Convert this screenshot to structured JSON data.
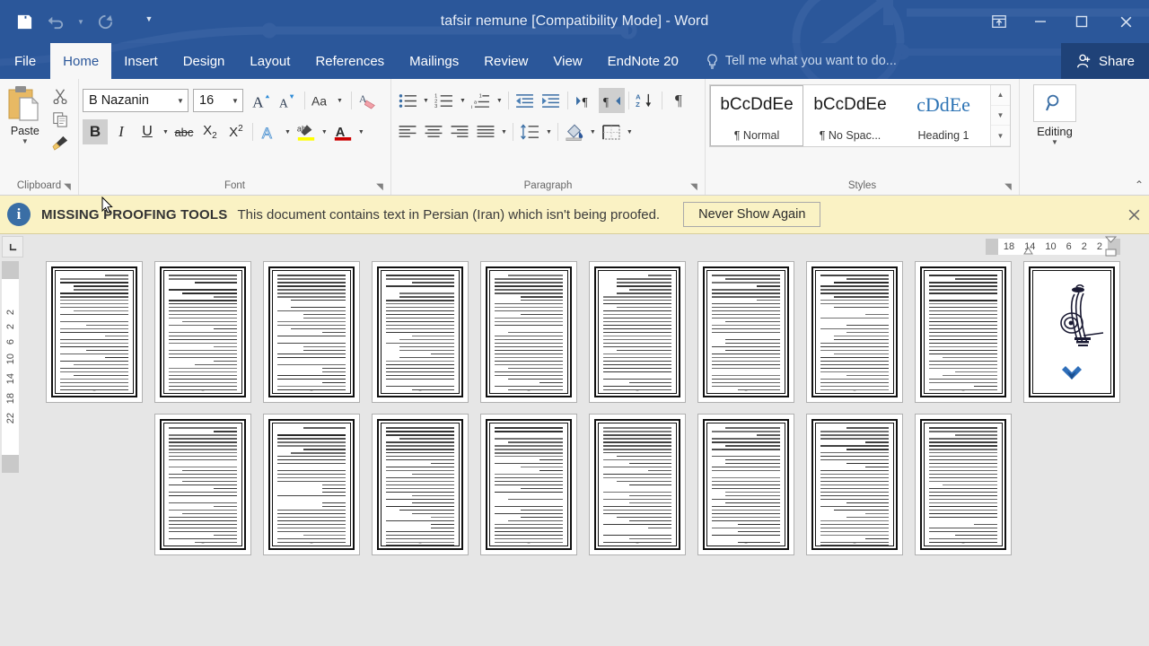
{
  "window": {
    "title": "tafsir nemune [Compatibility Mode] - Word",
    "quick_access": [
      {
        "name": "save-icon",
        "label": "Save",
        "enabled": true
      },
      {
        "name": "undo-icon",
        "label": "Undo",
        "enabled": false
      },
      {
        "name": "redo-icon",
        "label": "Repeat",
        "enabled": false
      },
      {
        "name": "customize-quick-access-toolbar-icon",
        "label": "Customize Quick Access Toolbar",
        "enabled": true
      }
    ],
    "controls": [
      {
        "name": "ribbon-display-options-icon",
        "label": "Ribbon Display Options"
      },
      {
        "name": "minimize-icon",
        "label": "Minimize"
      },
      {
        "name": "restore-icon",
        "label": "Restore Down"
      },
      {
        "name": "close-icon",
        "label": "Close"
      }
    ]
  },
  "tabs": [
    {
      "label": "File",
      "active": false
    },
    {
      "label": "Home",
      "active": true
    },
    {
      "label": "Insert",
      "active": false
    },
    {
      "label": "Design",
      "active": false
    },
    {
      "label": "Layout",
      "active": false
    },
    {
      "label": "References",
      "active": false
    },
    {
      "label": "Mailings",
      "active": false
    },
    {
      "label": "Review",
      "active": false
    },
    {
      "label": "View",
      "active": false
    },
    {
      "label": "EndNote 20",
      "active": false
    }
  ],
  "tell_me": "Tell me what you want to do...",
  "share": "Share",
  "ribbon": {
    "clipboard": {
      "label": "Clipboard",
      "paste": "Paste",
      "buttons": [
        "cut-icon",
        "copy-icon",
        "format-painter-icon"
      ]
    },
    "font": {
      "label": "Font",
      "font_name": "B Nazanin",
      "font_size": "16",
      "buttons": [
        "grow-font-icon",
        "shrink-font-icon",
        "change-case-icon",
        "clear-formatting-icon",
        "bold-icon",
        "italic-icon",
        "underline-icon",
        "strikethrough-icon",
        "subscript-icon",
        "superscript-icon",
        "text-effects-icon",
        "text-highlight-color-icon",
        "font-color-icon"
      ],
      "bold_active": true
    },
    "paragraph": {
      "label": "Paragraph",
      "buttons": [
        "bullets-icon",
        "numbering-icon",
        "multilevel-list-icon",
        "decrease-indent-icon",
        "increase-indent-icon",
        "ltr-text-direction-icon",
        "rtl-text-direction-icon",
        "sort-icon",
        "show-formatting-marks-icon",
        "align-left-icon",
        "align-center-icon",
        "align-right-icon",
        "justify-icon",
        "line-spacing-icon",
        "shading-icon",
        "borders-icon"
      ],
      "rtl_active": true
    },
    "styles": {
      "label": "Styles",
      "items": [
        {
          "preview": "bCcDdEe",
          "name": "¶ Normal",
          "selected": true
        },
        {
          "preview": "bCcDdEe",
          "name": "¶ No Spac...",
          "selected": false
        },
        {
          "preview": "cDdEe",
          "name": "Heading 1",
          "selected": false
        }
      ]
    },
    "editing": {
      "label": "Editing",
      "button": "Editing",
      "icon": "find-magnifier-icon"
    }
  },
  "message_bar": {
    "icon": "info-icon",
    "title": "MISSING PROOFING TOOLS",
    "text": "This document contains text in Persian (Iran) which isn't being proofed.",
    "button": "Never Show Again",
    "close": "×"
  },
  "rulers": {
    "tab_selector": "left-tab-stop-icon",
    "horizontal_numbers": [
      "18",
      "14",
      "10",
      "6",
      "2",
      "2"
    ],
    "vertical_numbers": [
      "2",
      "2",
      "6",
      "10",
      "14",
      "18",
      "22"
    ]
  },
  "document": {
    "view": "multiple-pages",
    "row1_pages": [
      {
        "kind": "text",
        "page_number": "–"
      },
      {
        "kind": "text",
        "page_number": "–"
      },
      {
        "kind": "text",
        "page_number": "–"
      },
      {
        "kind": "text",
        "page_number": "–"
      },
      {
        "kind": "text",
        "page_number": "–"
      },
      {
        "kind": "text",
        "page_number": "–"
      },
      {
        "kind": "text",
        "page_number": "–"
      },
      {
        "kind": "text",
        "page_number": "–"
      },
      {
        "kind": "text",
        "page_number": "–"
      },
      {
        "kind": "cover",
        "page_number": ""
      }
    ],
    "row2_pages": [
      {
        "kind": "text",
        "page_number": "–"
      },
      {
        "kind": "text",
        "page_number": "–"
      },
      {
        "kind": "text",
        "page_number": "–"
      },
      {
        "kind": "text",
        "page_number": "–"
      },
      {
        "kind": "text",
        "page_number": "–"
      },
      {
        "kind": "text",
        "page_number": "–"
      },
      {
        "kind": "text",
        "page_number": "–"
      },
      {
        "kind": "text",
        "page_number": "–"
      }
    ]
  },
  "colors": {
    "brand_blue": "#2b579a",
    "share_blue": "#1f4278",
    "message_bar": "#faf2c4",
    "workspace": "#e6e6e6",
    "ribbon": "#f7f7f7",
    "heading_blue": "#2e74b5",
    "highlight_yellow": "#ffff00",
    "font_color_red": "#cc0000"
  }
}
